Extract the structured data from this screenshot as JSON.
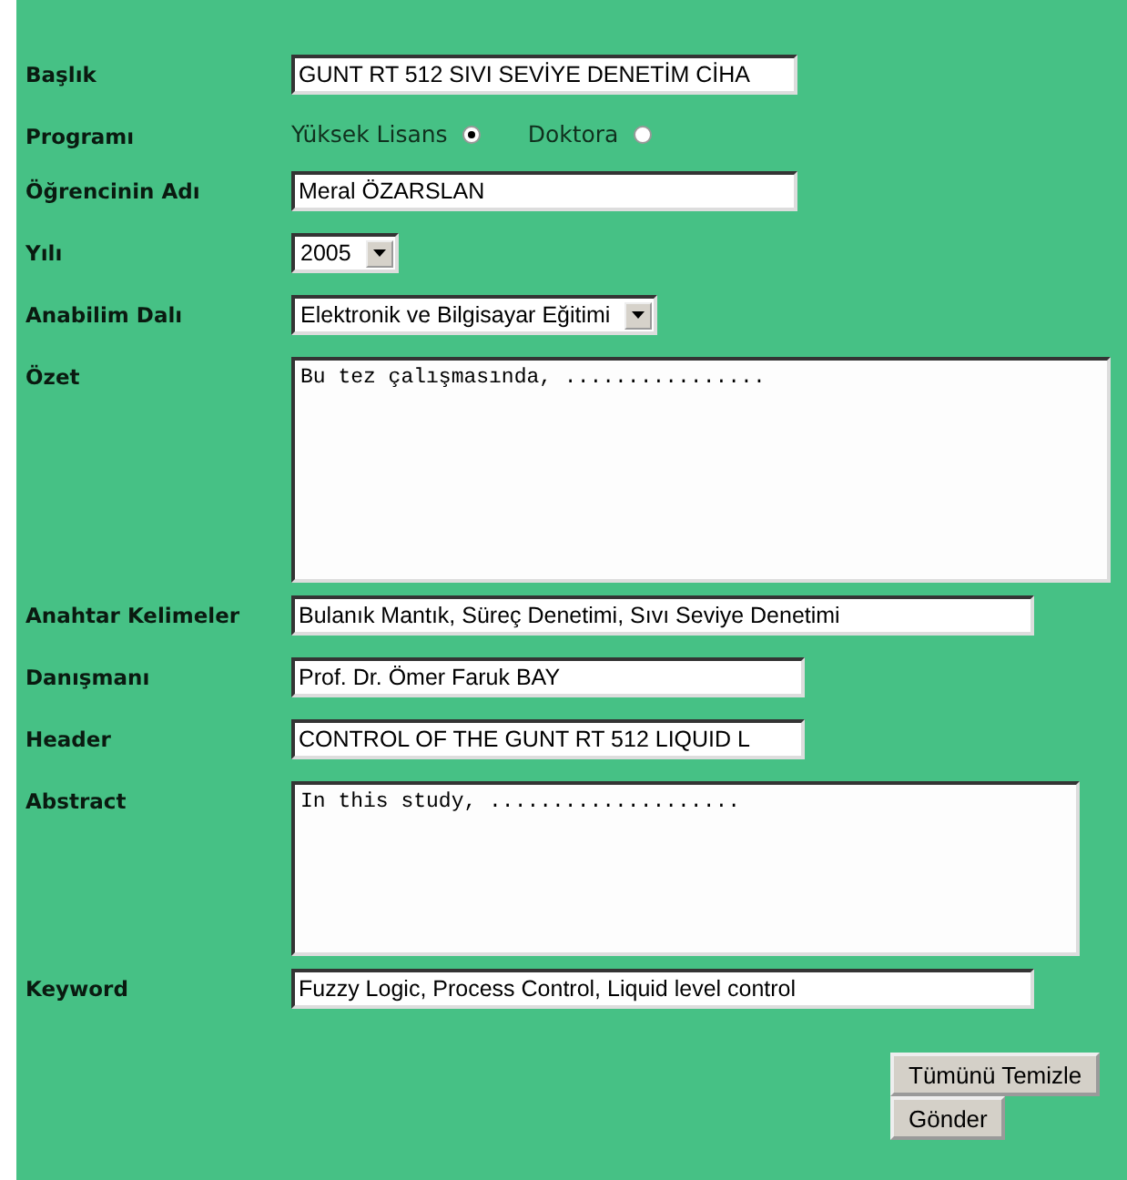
{
  "fields": [
    {
      "kind": "text",
      "label": "Başlık",
      "value": "GUNT RT 512 SIVI SEVİYE DENETİM CİHA"
    },
    {
      "kind": "radio",
      "label": "Programı",
      "options": [
        {
          "label": "Yüksek Lisans",
          "selected": true
        },
        {
          "label": "Doktora",
          "selected": false
        }
      ]
    },
    {
      "kind": "text",
      "label": "Öğrencinin Adı",
      "value": "Meral ÖZARSLAN"
    },
    {
      "kind": "select",
      "label": "Yılı",
      "value": "2005"
    },
    {
      "kind": "select",
      "label": "Anabilim Dalı",
      "value": "Elektronik ve Bilgisayar Eğitimi"
    },
    {
      "kind": "textarea",
      "label": "Özet",
      "value": "Bu tez çalışmasında, ................"
    },
    {
      "kind": "text",
      "label": "Anahtar Kelimeler",
      "value": "Bulanık Mantık, Süreç Denetimi, Sıvı Seviye Denetimi"
    },
    {
      "kind": "text",
      "label": "Danışmanı",
      "value": "Prof. Dr. Ömer Faruk BAY"
    },
    {
      "kind": "text",
      "label": "Header",
      "value": "CONTROL OF THE GUNT RT 512 LIQUID L"
    },
    {
      "kind": "textarea",
      "label": "Abstract",
      "value": "In this study, ...................."
    },
    {
      "kind": "text",
      "label": "Keyword",
      "value": "Fuzzy Logic, Process Control, Liquid level control"
    }
  ],
  "buttons": [
    "Tümünü Temizle",
    "Gönder"
  ]
}
